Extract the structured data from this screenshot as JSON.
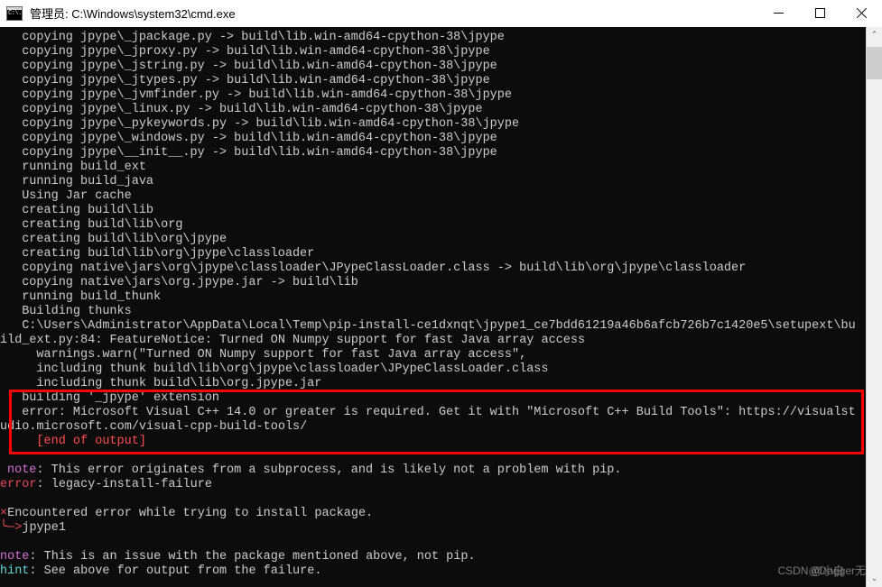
{
  "window": {
    "title": "管理员: C:\\Windows\\system32\\cmd.exe",
    "icon": "cmd-icon",
    "icon_prompt": "C:\\.",
    "controls": {
      "minimize": "minimize-button",
      "maximize": "maximize-button",
      "close": "close-button"
    }
  },
  "colors": {
    "console_bg": "#0c0c0c",
    "console_fg": "#cccccc",
    "annotation_box": "#ff0000",
    "error_red": "#e74856",
    "note_magenta": "#d670d6",
    "hint_cyan": "#61d6d6",
    "titlebar_bg": "#ffffff",
    "scrollbar_bg": "#f0f0f0",
    "scrollbar_thumb": "#cdcdcd"
  },
  "console": {
    "lines": [
      {
        "indent": "nopad",
        "color": "white",
        "text": "  copying jpype\\_jpackage.py -> build\\lib.win-amd64-cpython-38\\jpype"
      },
      {
        "indent": "nopad",
        "color": "white",
        "text": "  copying jpype\\_jproxy.py -> build\\lib.win-amd64-cpython-38\\jpype"
      },
      {
        "indent": "nopad",
        "color": "white",
        "text": "  copying jpype\\_jstring.py -> build\\lib.win-amd64-cpython-38\\jpype"
      },
      {
        "indent": "nopad",
        "color": "white",
        "text": "  copying jpype\\_jtypes.py -> build\\lib.win-amd64-cpython-38\\jpype"
      },
      {
        "indent": "nopad",
        "color": "white",
        "text": "  copying jpype\\_jvmfinder.py -> build\\lib.win-amd64-cpython-38\\jpype"
      },
      {
        "indent": "nopad",
        "color": "white",
        "text": "  copying jpype\\_linux.py -> build\\lib.win-amd64-cpython-38\\jpype"
      },
      {
        "indent": "nopad",
        "color": "white",
        "text": "  copying jpype\\_pykeywords.py -> build\\lib.win-amd64-cpython-38\\jpype"
      },
      {
        "indent": "nopad",
        "color": "white",
        "text": "  copying jpype\\_windows.py -> build\\lib.win-amd64-cpython-38\\jpype"
      },
      {
        "indent": "nopad",
        "color": "white",
        "text": "  copying jpype\\__init__.py -> build\\lib.win-amd64-cpython-38\\jpype"
      },
      {
        "indent": "nopad",
        "color": "white",
        "text": "  running build_ext"
      },
      {
        "indent": "nopad",
        "color": "white",
        "text": "  running build_java"
      },
      {
        "indent": "nopad",
        "color": "white",
        "text": "  Using Jar cache"
      },
      {
        "indent": "nopad",
        "color": "white",
        "text": "  creating build\\lib"
      },
      {
        "indent": "nopad",
        "color": "white",
        "text": "  creating build\\lib\\org"
      },
      {
        "indent": "nopad",
        "color": "white",
        "text": "  creating build\\lib\\org\\jpype"
      },
      {
        "indent": "nopad",
        "color": "white",
        "text": "  creating build\\lib\\org\\jpype\\classloader"
      },
      {
        "indent": "nopad",
        "color": "white",
        "text": "  copying native\\jars\\org\\jpype\\classloader\\JPypeClassLoader.class -> build\\lib\\org\\jpype\\classloader"
      },
      {
        "indent": "nopad",
        "color": "white",
        "text": "  copying native\\jars\\org.jpype.jar -> build\\lib"
      },
      {
        "indent": "nopad",
        "color": "white",
        "text": "  running build_thunk"
      },
      {
        "indent": "nopad",
        "color": "white",
        "text": "  Building thunks"
      },
      {
        "indent": "nopad",
        "color": "white",
        "text": "  C:\\Users\\Administrator\\AppData\\Local\\Temp\\pip-install-ce1dxnqt\\jpype1_ce7bdd61219a46b6afcb726b7c1420e5\\setupext\\bu"
      },
      {
        "indent": "pad0",
        "color": "white",
        "text": "ild_ext.py:84: FeatureNotice: Turned ON Numpy support for fast Java array access"
      },
      {
        "indent": "nopad",
        "color": "white",
        "text": "    warnings.warn(\"Turned ON Numpy support for fast Java array access\","
      },
      {
        "indent": "nopad",
        "color": "white",
        "text": "    including thunk build\\lib\\org\\jpype\\classloader\\JPypeClassLoader.class"
      },
      {
        "indent": "nopad",
        "color": "white",
        "text": "    including thunk build\\lib\\org.jpype.jar"
      },
      {
        "indent": "nopad",
        "color": "white",
        "text": "  building '_jpype' extension"
      },
      {
        "indent": "nopad",
        "color": "white",
        "text": "  error: Microsoft Visual C++ 14.0 or greater is required. Get it with \"Microsoft C++ Build Tools\": https://visualst"
      },
      {
        "indent": "pad0",
        "color": "white",
        "text": "udio.microsoft.com/visual-cpp-build-tools/"
      },
      {
        "indent": "nopad",
        "color": "brightred",
        "text": "    [end of output]"
      },
      {
        "indent": "nopad",
        "color": "white",
        "text": ""
      },
      {
        "indent": "nopad",
        "color": "white",
        "text": ""
      },
      {
        "indent": "nopad",
        "color": "white",
        "text": ""
      }
    ],
    "note1": {
      "label": "note",
      "body": ": This error originates from a subprocess, and is likely not a problem with pip."
    },
    "error_line": {
      "label": "error",
      "body": ": legacy-install-failure"
    },
    "encountered": {
      "mark": "×",
      "text": "Encountered error while trying to install package."
    },
    "package": {
      "arrow": "╰─>",
      "name": "jpype1"
    },
    "note2": {
      "label": "note",
      "body": ": This is an issue with the package mentioned above, not pip."
    },
    "hint": {
      "label": "hint",
      "body": ": See above for output from the failure."
    }
  },
  "annotation": {
    "type": "red-rectangle-highlight",
    "highlights": "error: Microsoft Visual C++ 14.0 or greater is required"
  },
  "scrollbar": {
    "up_arrow": "⌃",
    "down_arrow": "⌄"
  },
  "watermark": {
    "text1": "CSDN @小白",
    "text2": "@Dagger无敌"
  }
}
